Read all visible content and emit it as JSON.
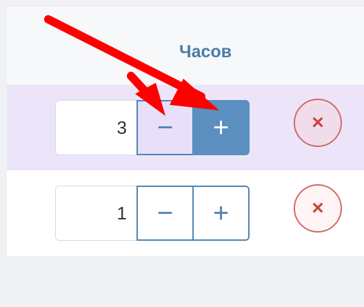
{
  "table": {
    "column_header": "Часов",
    "rows": [
      {
        "quantity": "3",
        "minus_label": "−",
        "plus_label": "+",
        "remove_label": "×",
        "highlighted": true
      },
      {
        "quantity": "1",
        "minus_label": "−",
        "plus_label": "+",
        "remove_label": "×",
        "highlighted": false
      }
    ]
  },
  "colors": {
    "accent": "#4e84b4",
    "highlight_row": "#ece5fa",
    "remove": "#c8463c",
    "annotation_arrow": "#ff0000"
  },
  "annotation": {
    "type": "arrows",
    "target": "plus-button"
  }
}
